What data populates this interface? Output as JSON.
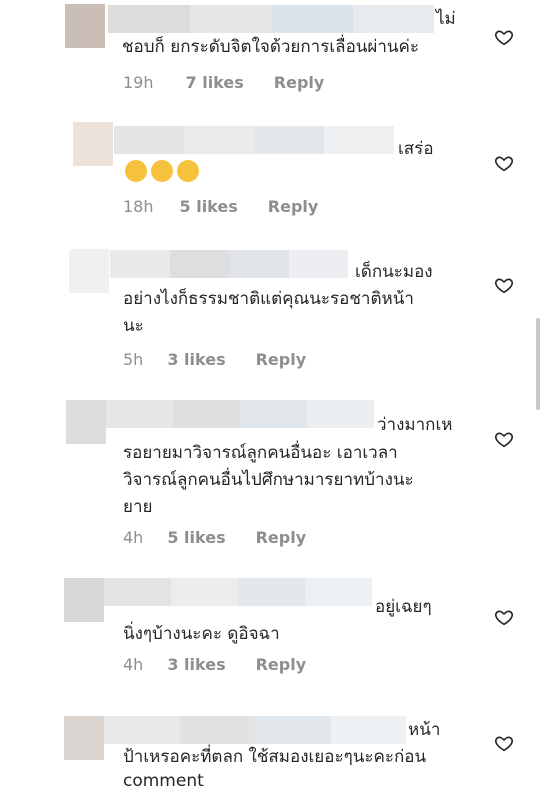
{
  "comments": [
    {
      "text_lines": [
        "ไม่",
        "ชอบก็ ยกระดับจิตใจด้วยการเลื่อนผ่านค่ะ"
      ],
      "time": "19h",
      "likes": "7 likes",
      "reply": "Reply"
    },
    {
      "text_lines": [
        "เสร่อ",
        "😒😒😒"
      ],
      "time": "18h",
      "likes": "5 likes",
      "reply": "Reply"
    },
    {
      "text_lines": [
        "เด็กนะมอง",
        "อย่างไงก็ธรรมชาติแต่คุณนะรอชาติหน้า",
        "นะ"
      ],
      "time": "5h",
      "likes": "3 likes",
      "reply": "Reply"
    },
    {
      "text_lines": [
        "ว่างมากเห",
        "รอยายมาวิจารณ์ลูกคนอื่นอะ เอาเวลา",
        "วิจารณ์ลูกคนอื่นไปศึกษามารยาทบ้างนะ",
        "ยาย"
      ],
      "time": "4h",
      "likes": "5 likes",
      "reply": "Reply"
    },
    {
      "text_lines": [
        "อยู่เฉยๆ",
        "นิ่งๆบ้างนะคะ ดูอิจฉา"
      ],
      "time": "4h",
      "likes": "3 likes",
      "reply": "Reply"
    },
    {
      "text_lines": [
        "หน้า",
        "ป้าเหรอคะที่ตลก ใช้สมองเยอะๆนะคะก่อน",
        "comment"
      ]
    }
  ],
  "icons": {
    "like": "heart-outline-icon"
  },
  "colors": {
    "text": "#262626",
    "meta": "#8e8e8e",
    "background": "#ffffff"
  }
}
